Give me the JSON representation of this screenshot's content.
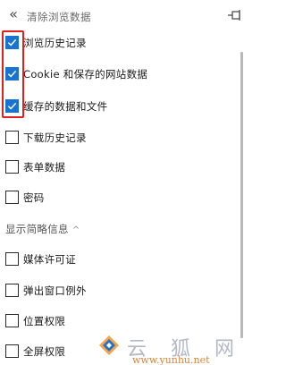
{
  "header": {
    "back_glyph": "«",
    "title": "清除浏览数据",
    "pin_icon": "pin-icon"
  },
  "items": [
    {
      "label": "浏览历史记录",
      "checked": true
    },
    {
      "label": "Cookie 和保存的网站数据",
      "checked": true
    },
    {
      "label": "缓存的数据和文件",
      "checked": true
    },
    {
      "label": "下载历史记录",
      "checked": false
    },
    {
      "label": "表单数据",
      "checked": false
    },
    {
      "label": "密码",
      "checked": false
    }
  ],
  "section": {
    "label": "显示简略信息",
    "chevron": "^"
  },
  "more_items": [
    {
      "label": "媒体许可证",
      "checked": false
    },
    {
      "label": "弹出窗口例外",
      "checked": false
    },
    {
      "label": "位置权限",
      "checked": false
    },
    {
      "label": "全屏权限",
      "checked": false
    }
  ],
  "watermark": {
    "brand": "云 狐 网",
    "url": "www.yunhu.net"
  },
  "colors": {
    "accent": "#1a73d1",
    "highlight": "#e01f1f",
    "watermark_url": "#d9843a"
  }
}
